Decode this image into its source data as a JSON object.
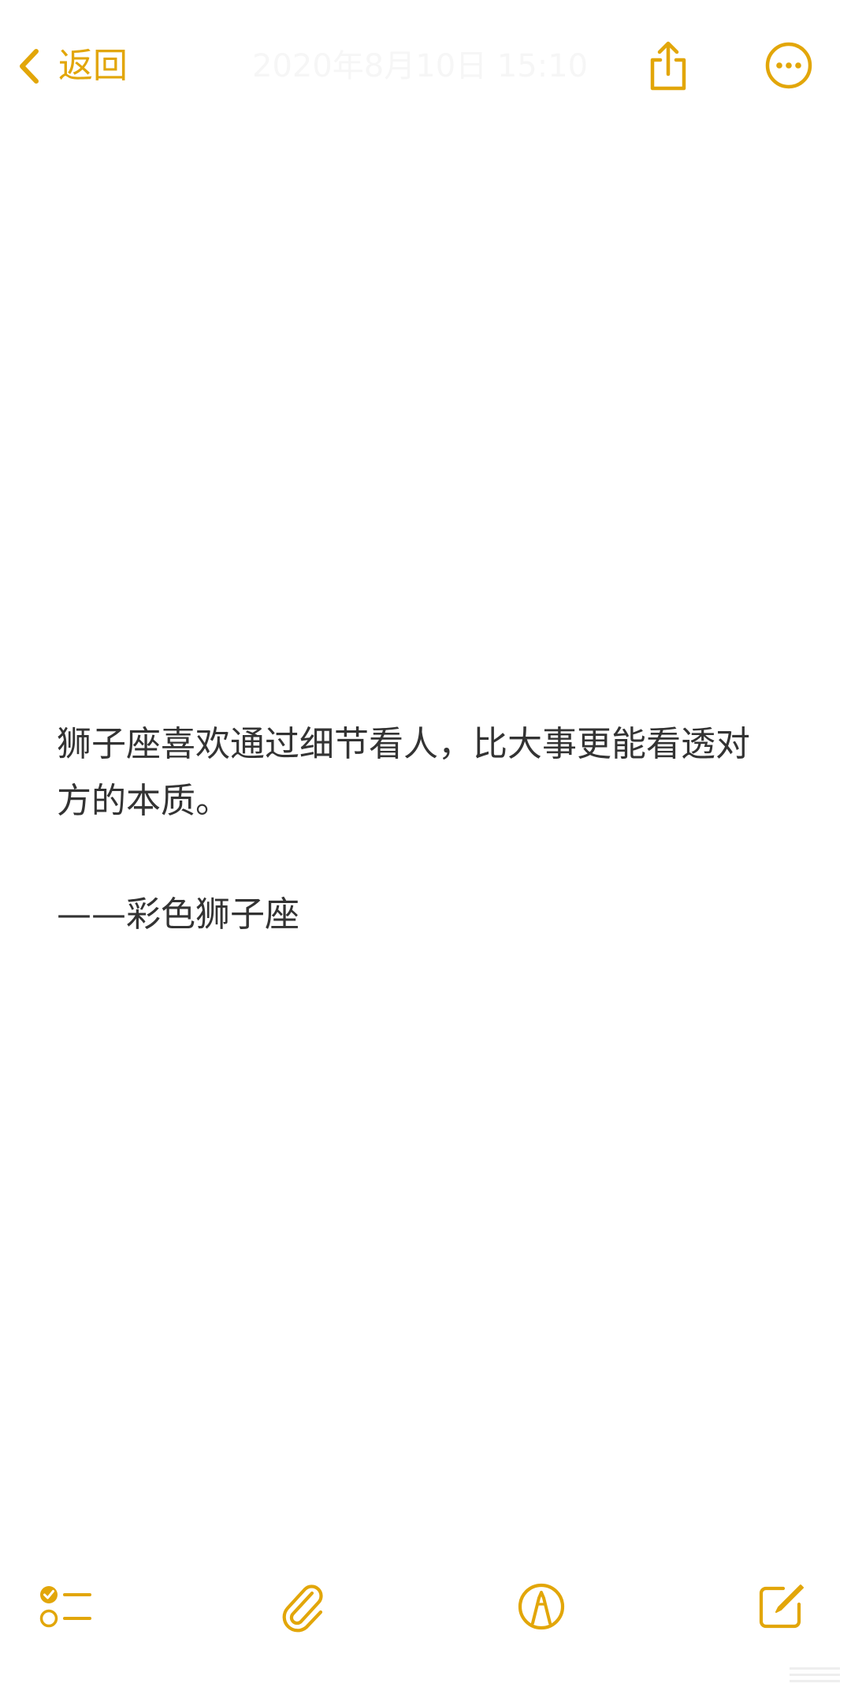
{
  "colors": {
    "accent": "#e2a609",
    "text": "#333333",
    "background": "#ffffff"
  },
  "header": {
    "back_label": "返回",
    "date_title": "2020年8月10日 15:10",
    "icons": {
      "back": "chevron-left-icon",
      "share": "share-icon",
      "more": "more-icon"
    }
  },
  "note": {
    "paragraph_line1": "狮子座喜欢通过细节看人，比大事更能看透对",
    "paragraph_line2": "方的本质。",
    "signature": "——彩色狮子座"
  },
  "toolbar": {
    "icons": [
      "checklist-icon",
      "paperclip-icon",
      "markup-icon",
      "compose-icon"
    ]
  }
}
